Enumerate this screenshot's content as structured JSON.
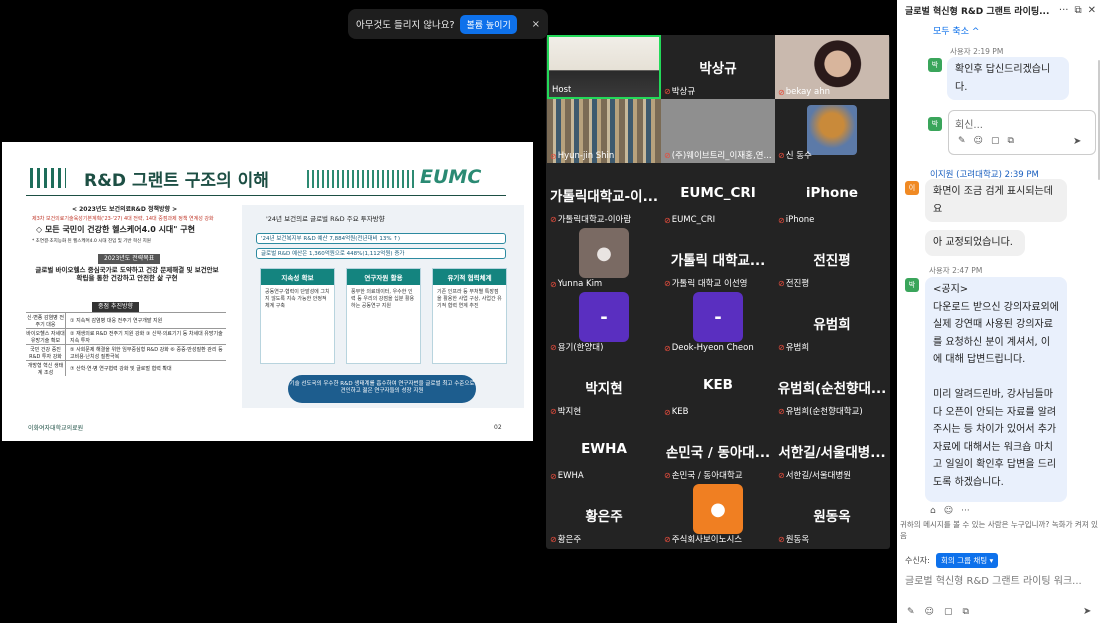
{
  "notification": {
    "text": "아무것도 들리지 않나요?",
    "button": "볼륨 높이기",
    "close": "×"
  },
  "slide": {
    "title": "R&D 그랜트 구조의 이해",
    "logo": "EUMC",
    "left": {
      "policy_header": "< 2023년도 보건의료R&D 정책방향 >",
      "policy_red": "제3차 보건의료기술육성기본계획('23-'27) 4대 전략, 14대 중점과제 정책 연계성 강화",
      "vision": "◇ 모든 국민이 건강한 헬스케어4.0 시대\" 구현",
      "vision_note": "* 초연결·초지능화 된 헬스케어4.0 시대 진입 및 기반 혁신 지원",
      "goal_header": "2023년도 전략목표",
      "goal_text": "글로벌 바이오헬스 중심국가로 도약하고 건강 문제해결 및 보건안보 확립을 통한 건강하고 안전한 삶 구현",
      "strategy_header": "중점 추진방향",
      "rows": [
        {
          "cat": "신·변종 감염병 전주기 대응",
          "text": "① 지속적 감염병 대응 전주기 연구개발 지원"
        },
        {
          "cat": "바이오헬스 자세대 유망기술 확보",
          "text": "② 재생의료 R&D 전주기 지원 강화  ③ 신약·의료기기 등 차세대 유망기술 지속 투자"
        },
        {
          "cat": "국민 건강 증진 R&D 투자 강화",
          "text": "⑤ 사회문제 해결을 위한 임무중심형 R&D 강화  ⑥ 중증·만성질환 관리 등 고비용·난치성 질환극복"
        },
        {
          "cat": "개방형 혁신 생태계 조성",
          "text": "⑦ 산학·연·병 연구협력 강화 및 글로벌 협력 확대"
        }
      ]
    },
    "right": {
      "title": "'24년 보건의료 글로벌 R&D 주요 투자방향",
      "pill1": "'24년 보건복지부 R&D 예산 7,884억원(전년대비 13% ↑)",
      "pill2": "글로벌 R&D 예산은 1,360억원으로 448%(1,112억원) 증가",
      "cards": [
        {
          "head": "지속성 확보",
          "body": "공동연구·협력이 단발성에 그치지 않도록 지속 가능한 안정적 체계 구축"
        },
        {
          "head": "연구자원 활용",
          "body": "풍부한 의료데이터, 우수한 인력 등 우리의 강점을 십분 활용하는 공동연구 지원"
        },
        {
          "head": "유기적 협력체계",
          "body": "기존 인프라 등 부처별 특장점을 활용한 사업 구상, 사업간 유기적 협력 연계 추진"
        }
      ],
      "banner": "기술 선도국의 우수한 R&D 생태계를 흡수하여 연구자번을 글로벌 최고 수준으로 견인하고 젊은 연구자들의 성장 지원"
    },
    "hospital": "이화여자대학교의료원",
    "page": "02"
  },
  "gallery": [
    {
      "big": "",
      "name": "Host",
      "muted": false
    },
    {
      "big": "박상규",
      "name": "박상규",
      "muted": true
    },
    {
      "big": "",
      "name": "bekay ahn",
      "muted": true
    },
    {
      "big": "",
      "name": "Hyun-jin Shin",
      "muted": true
    },
    {
      "big": "",
      "name": "(주)웨이브트리_이재홍,연...",
      "muted": true
    },
    {
      "big": "",
      "name": "신 동수",
      "muted": true
    },
    {
      "big": "가톨릭대학교-이...",
      "name": "가톨릭대학교-이아람",
      "muted": true
    },
    {
      "big": "EUMC_CRI",
      "name": "EUMC_CRI",
      "muted": true
    },
    {
      "big": "iPhone",
      "name": "iPhone",
      "muted": true
    },
    {
      "big": "",
      "name": "Yunna Kim",
      "muted": true
    },
    {
      "big": "가톨릭 대학교...",
      "name": "가톨릭 대학교 이선영",
      "muted": true
    },
    {
      "big": "전진평",
      "name": "전진평",
      "muted": true
    },
    {
      "big": "",
      "name": "용기(한양대)",
      "muted": true,
      "avatar": "-"
    },
    {
      "big": "",
      "name": "Deok-Hyeon Cheon",
      "muted": true,
      "avatar": "-"
    },
    {
      "big": "유범희",
      "name": "유범희",
      "muted": true
    },
    {
      "big": "박지현",
      "name": "박지현",
      "muted": true
    },
    {
      "big": "KEB",
      "name": "KEB",
      "muted": true
    },
    {
      "big": "유범희(순천향대...",
      "name": "유범희(순천향대학교)",
      "muted": true
    },
    {
      "big": "EWHA",
      "name": "EWHA",
      "muted": true
    },
    {
      "big": "손민국 / 동아대...",
      "name": "손민국 / 동아대학교",
      "muted": true
    },
    {
      "big": "서한길/서울대병...",
      "name": "서한길/서울대병원",
      "muted": true
    },
    {
      "big": "황은주",
      "name": "황은주",
      "muted": true
    },
    {
      "big": "",
      "name": "주식회사보이노시스",
      "muted": true
    },
    {
      "big": "원동옥",
      "name": "원동옥",
      "muted": true
    }
  ],
  "chat": {
    "title": "글로벌 혁신형 R&D 그랜트 라이팅...",
    "collapse": "모두 축소 ^",
    "msg1_meta": "사용자 2:19 PM",
    "msg1_avatar": "박",
    "msg1_text": "확인후 답신드리겠습니다.",
    "reply_avatar": "박",
    "reply_placeholder": "회신...",
    "msg2_sender": "이지원 (고려대학교) 2:39 PM",
    "msg2_avatar": "이",
    "msg2_text1": "화면이 조금 검게 표시되는데요",
    "msg2_text2": "아 교정되었습니다.",
    "msg3_meta": "사용자 2:47 PM",
    "msg3_avatar": "박",
    "msg3_text": "<공지>\n다운로드 받으신 강의자료외에 실제 강연때 사용된 강의자료를 요청하신 분이 계셔서, 이에 대해 답변드립니다.\n\n미리 알려드린바, 강사님들마다 오픈이 안되는 자료를 알려주시는 등 차이가 있어서 추가 자료에 대해서는 워크숍 마치고 일일이 확인후 답변을 드리도록 하겠습니다.",
    "privacy": "귀하의 메시지를 볼 수 있는 사람은 누구입니까? 녹화가 켜져 있음",
    "to_label": "수신자:",
    "to_value": "회의 그룹 채팅 ▾",
    "compose_placeholder": "글로벌 혁신형 R&D 그랜트 라이팅 워크...",
    "colors": {
      "accent": "#0e71eb",
      "bubble": "#e9f0fc",
      "avatar_green": "#3aa55b",
      "avatar_orange": "#f08a24"
    }
  }
}
